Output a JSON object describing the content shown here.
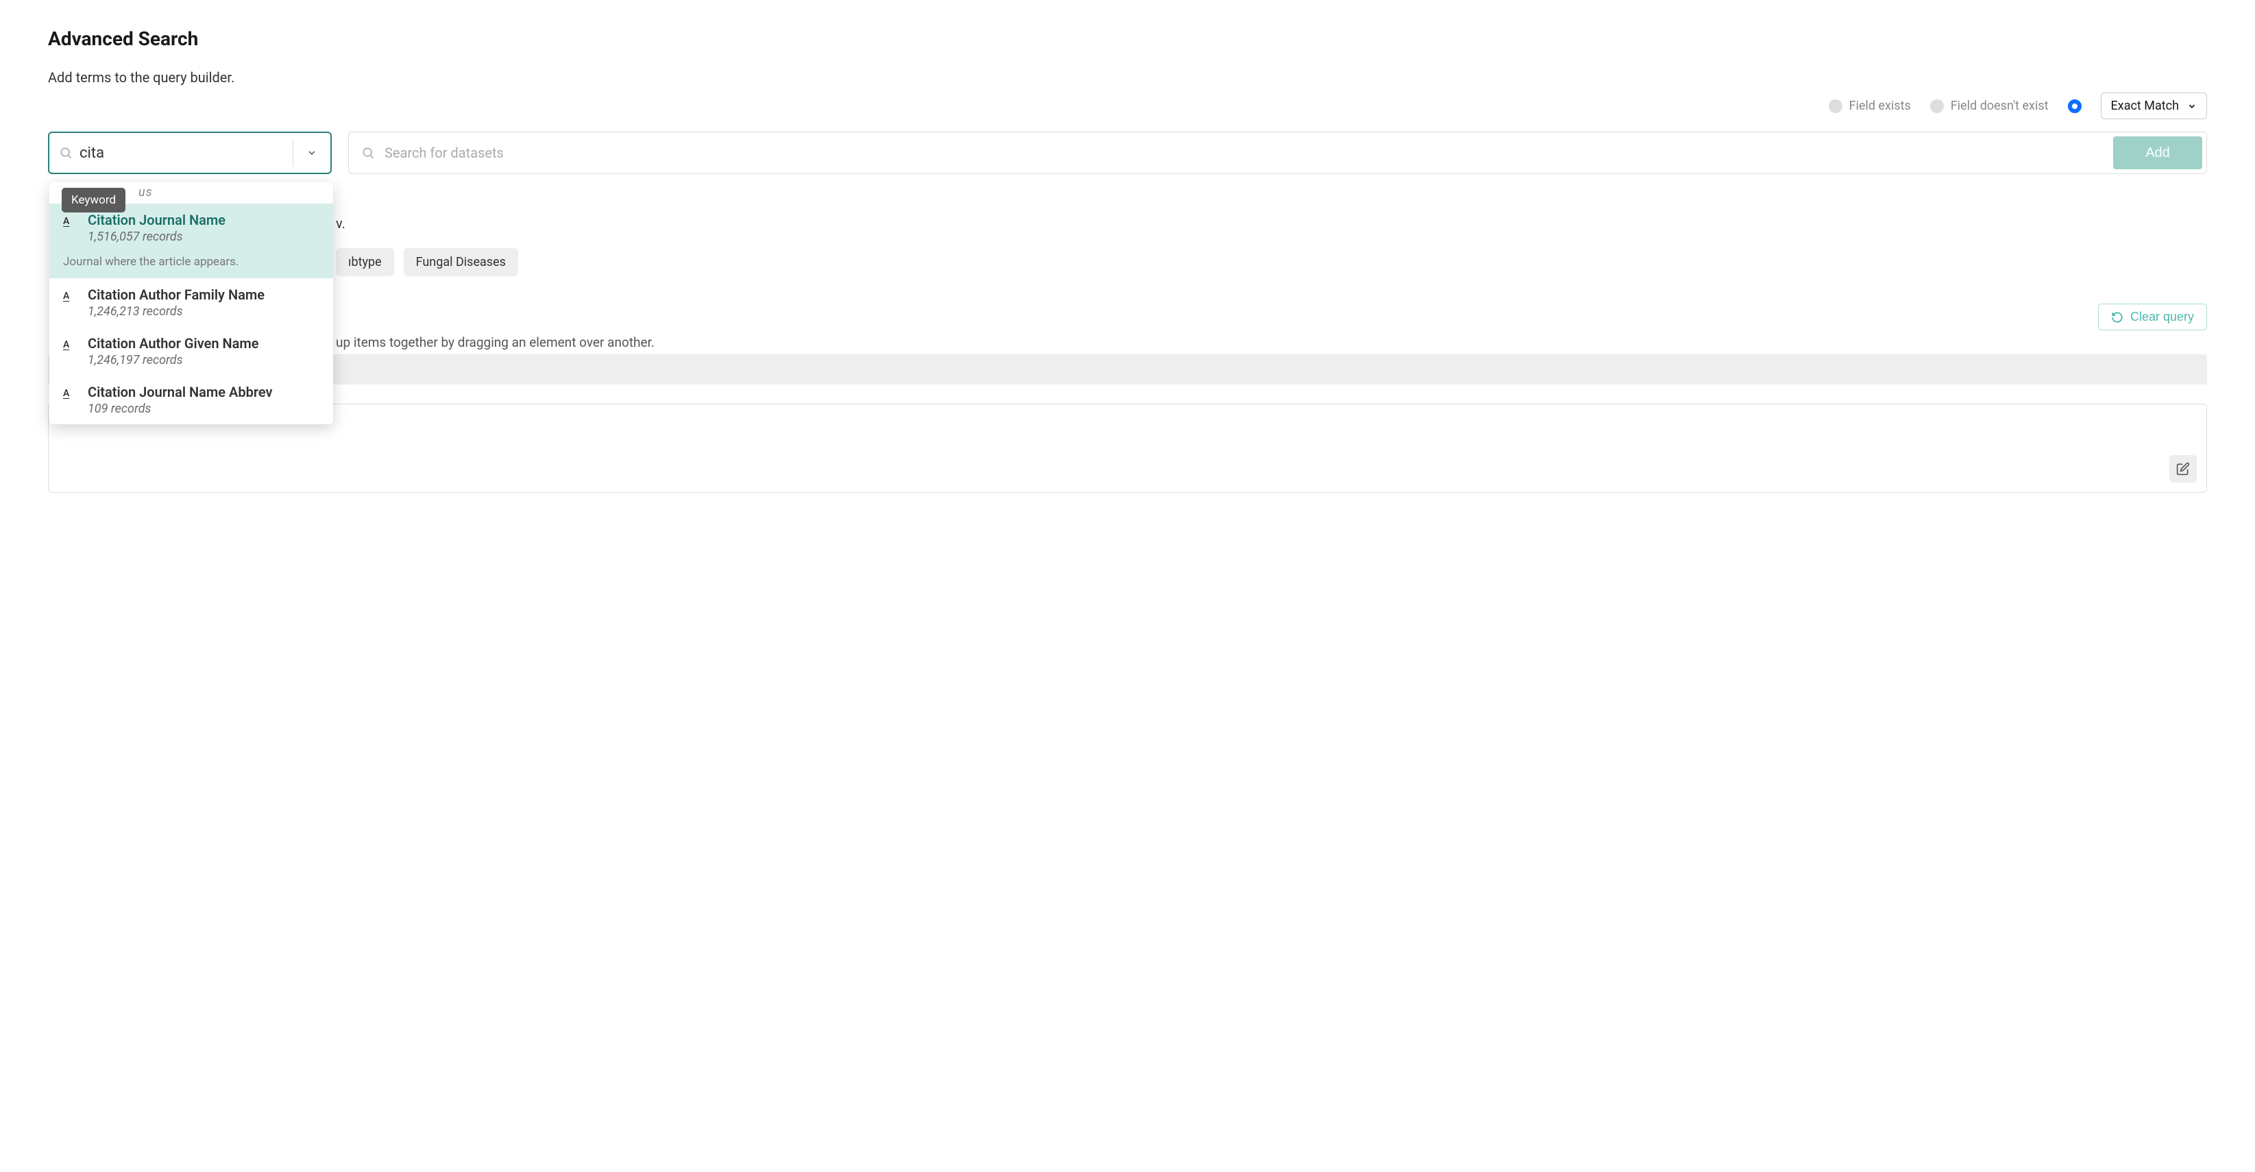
{
  "header": {
    "title": "Advanced Search",
    "subtitle": "Add terms to the query builder."
  },
  "options": {
    "field_exists": "Field exists",
    "field_not_exists": "Field doesn't exist",
    "match_mode": "Exact Match"
  },
  "field_search": {
    "value": "cita"
  },
  "dataset_search": {
    "placeholder": "Search for datasets",
    "add_label": "Add"
  },
  "tooltip": {
    "keyword": "Keyword"
  },
  "dropdown": {
    "truncated_top": "us",
    "items": [
      {
        "title": "Citation Journal Name",
        "records": "1,516,057 records",
        "desc": "Journal where the article appears.",
        "hl": true
      },
      {
        "title": "Citation Author Family Name",
        "records": "1,246,213 records"
      },
      {
        "title": "Citation Author Given Name",
        "records": "1,246,197 records"
      },
      {
        "title": "Citation Journal Name Abbrev",
        "records": "109 records"
      }
    ]
  },
  "background": {
    "line1_suffix": "v.",
    "chips": [
      "ıbtype",
      "Fungal Diseases"
    ],
    "clear_label": "Clear query",
    "drag_hint": "up items together by dragging an element over another."
  }
}
